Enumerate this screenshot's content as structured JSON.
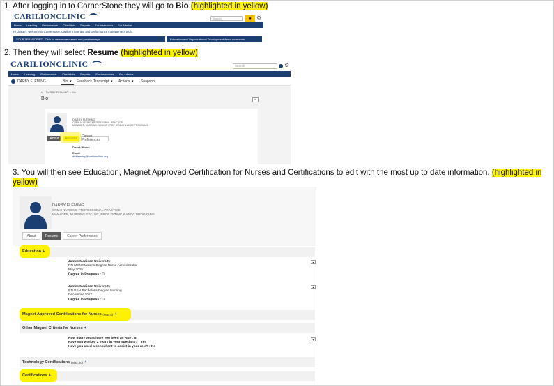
{
  "steps": {
    "s1_text": "1. After logging in to CornerStone they will go to ",
    "s1_bold": "Bio",
    "s1_hl": "(highlighted in yellow)",
    "s2_text": "2. Then they will select ",
    "s2_bold": "Resume",
    "s2_hl": "(highlighted in yellow)",
    "s3_text": "3.  You will then see Education, Magnet Approved Certification for Nurses and Certifications to edit with the most up to date information. ",
    "s3_hl_a": "(highlighted in",
    "s3_hl_b": "yellow)"
  },
  "brand": {
    "logo": "CARILIONCLINIC",
    "nav_color": "#1b3f73",
    "highlight_color": "#fff200"
  },
  "shot1": {
    "search_placeholder": "Search",
    "nav": [
      "Home",
      "Learning",
      "Performance",
      "Checklists",
      "Reports",
      "For Instructors",
      "For Admins"
    ],
    "welcome": "Hi DARBY, welcome to Cornerstone, Carilion's learning and performance management tool!",
    "transcript_btn": "YOUR TRANSCRIPT - Click to view more current and past trainings",
    "edu_btn": "Education and Organizational Development Announcements"
  },
  "shot2": {
    "search_placeholder": "Search",
    "nav": [
      "Home",
      "Learning",
      "Performance",
      "Checklists",
      "Reports",
      "For Instructors",
      "For Admins"
    ],
    "user": "DARBY FLEMING",
    "subnav": [
      "Bio",
      "Feedback",
      "Transcript",
      "Actions",
      "Snapshot"
    ],
    "breadcrumb": "DARBY FLEMING  >  Bio",
    "title": "Bio",
    "name": "DARBY FLEMING",
    "dept": "CRMH NURSING PROFESSIONAL PRACTICE",
    "role": "MANAGER, NURSING EXCLNC, PROF DVMNC & ANCC PROGRAMS",
    "tabs": [
      "About",
      "Resume",
      "Career Preferences"
    ],
    "direct_phone": "Direct Phone",
    "email_label": "Email",
    "email": "dmfleming@carilionclinic.org"
  },
  "shot3": {
    "name": "DARBY FLEMING",
    "dept": "CRMH NURSING PROFESSIONAL PRACTICE",
    "role": "MANAGER, NURSING EXCLNC, PROF DVMNC & ANCC PROGRAMS",
    "tabs": [
      "About",
      "Resume",
      "Career Preferences"
    ],
    "education": "Education",
    "edu1_school": "James Madison University",
    "edu1_degree": "RN MSN Master's Degree     Nurse Administrator",
    "edu1_date": "May 2025",
    "edu1_prog": "Degree in Progress :",
    "edu2_school": "James Madison University",
    "edu2_degree": "RN BSN Bachelor's Degree     Nursing",
    "edu2_date": "December 2017",
    "edu2_prog": "Degree In Progress :",
    "magnet": "Magnet Approved Certifications for Nurses",
    "magnet_max": "(Max:8)",
    "other": "Other Magnet Criteria for Nurses",
    "q1": "How many years have you been an RN? : 8",
    "q2": "Have you worked 2 years in your specialty? : Yes",
    "q3": "Have you used a consultant to assist in your role? : No",
    "tech": "Technology Certifications",
    "tech_max": "(Max:20)",
    "certs": "Certifications"
  }
}
